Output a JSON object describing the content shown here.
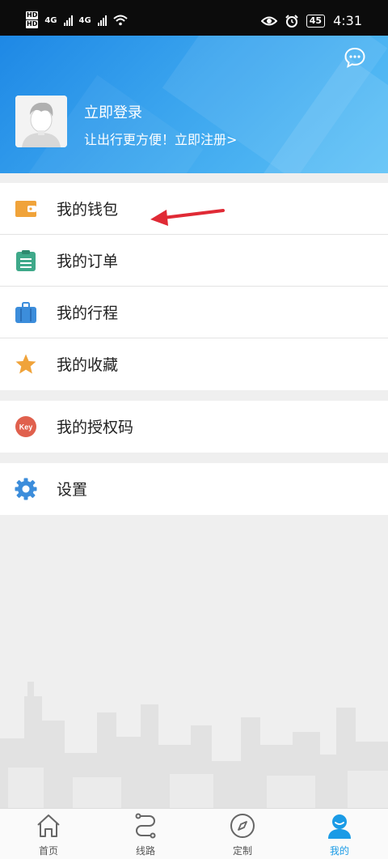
{
  "status_bar": {
    "sim1": "HD",
    "sim2": "HD",
    "net1": "4G",
    "net2": "4G",
    "battery": "45",
    "time": "4:31"
  },
  "header": {
    "login_label": "立即登录",
    "register_prompt": "让出行更方便！立即注册>"
  },
  "menu": {
    "group1": [
      {
        "label": "我的钱包",
        "icon": "wallet-icon",
        "color": "#f0a33a"
      },
      {
        "label": "我的订单",
        "icon": "order-list-icon",
        "color": "#3fa98a"
      },
      {
        "label": "我的行程",
        "icon": "suitcase-icon",
        "color": "#3c8ddb"
      },
      {
        "label": "我的收藏",
        "icon": "star-icon",
        "color": "#f0a33a"
      }
    ],
    "group2": [
      {
        "label": "我的授权码",
        "icon": "key-badge-icon",
        "badge_text": "Key",
        "color": "#e0604d"
      }
    ],
    "group3": [
      {
        "label": "设置",
        "icon": "gear-icon",
        "color": "#3c8ddb"
      }
    ]
  },
  "tabs": [
    {
      "label": "首页",
      "icon": "home-icon",
      "active": false
    },
    {
      "label": "线路",
      "icon": "route-icon",
      "active": false
    },
    {
      "label": "定制",
      "icon": "compass-icon",
      "active": false
    },
    {
      "label": "我的",
      "icon": "user-icon",
      "active": true
    }
  ],
  "colors": {
    "header_start": "#1e88e5",
    "header_end": "#5cc1f6",
    "active_tab": "#1a9be6",
    "annotation_arrow": "#e02a35"
  }
}
